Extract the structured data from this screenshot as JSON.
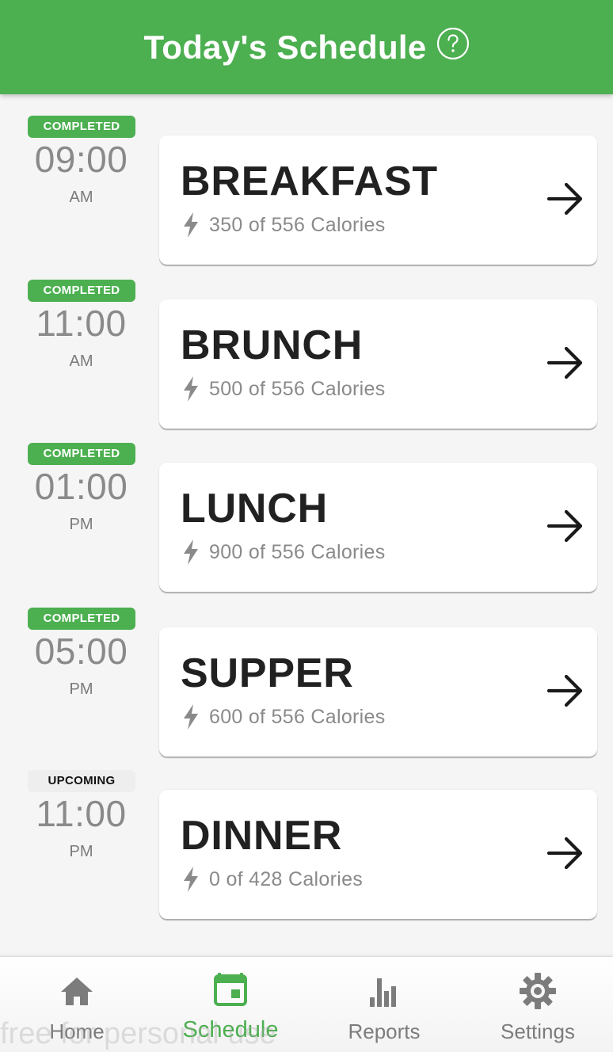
{
  "header": {
    "title": "Today's Schedule",
    "background": "#4caf50"
  },
  "meals": [
    {
      "status": "COMPLETED",
      "time": "09:00",
      "period": "AM",
      "name": "BREAKFAST",
      "calories": "350 of 556 Calories"
    },
    {
      "status": "COMPLETED",
      "time": "11:00",
      "period": "AM",
      "name": "BRUNCH",
      "calories": "500 of 556 Calories"
    },
    {
      "status": "COMPLETED",
      "time": "01:00",
      "period": "PM",
      "name": "LUNCH",
      "calories": "900 of 556 Calories"
    },
    {
      "status": "COMPLETED",
      "time": "05:00",
      "period": "PM",
      "name": "SUPPER",
      "calories": "600 of 556 Calories"
    },
    {
      "status": "UPCOMING",
      "time": "11:00",
      "period": "PM",
      "name": "DINNER",
      "calories": "0 of 428 Calories"
    }
  ],
  "nav": {
    "items": [
      {
        "label": "Home",
        "icon": "home-icon"
      },
      {
        "label": "Schedule",
        "icon": "calendar-icon",
        "active": true
      },
      {
        "label": "Reports",
        "icon": "bar-chart-icon"
      },
      {
        "label": "Settings",
        "icon": "gear-icon"
      }
    ],
    "active_color": "#4caf50",
    "inactive_color": "#7c7c7c"
  },
  "watermark": "free for personal use"
}
